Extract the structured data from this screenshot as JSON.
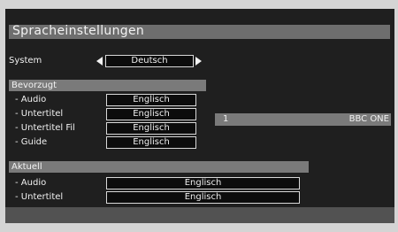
{
  "title": "Spracheinstellungen",
  "system": {
    "label": "System",
    "value": "Deutsch"
  },
  "preferred": {
    "header": "Bevorzugt",
    "rows": [
      {
        "label": "- Audio",
        "value": "Englisch"
      },
      {
        "label": "- Untertitel",
        "value": "Englisch"
      },
      {
        "label": "- Untertitel Fil",
        "value": "Englisch"
      },
      {
        "label": "- Guide",
        "value": "Englisch"
      }
    ]
  },
  "channel": {
    "number": "1",
    "name": "BBC ONE"
  },
  "current": {
    "header": "Aktuell",
    "rows": [
      {
        "label": "- Audio",
        "value": "Englisch"
      },
      {
        "label": "- Untertitel",
        "value": "Englisch"
      }
    ]
  },
  "colors": {
    "background": "#1f1f1f",
    "bar": "#7a7a7a",
    "frame": "#d4d4d4"
  }
}
